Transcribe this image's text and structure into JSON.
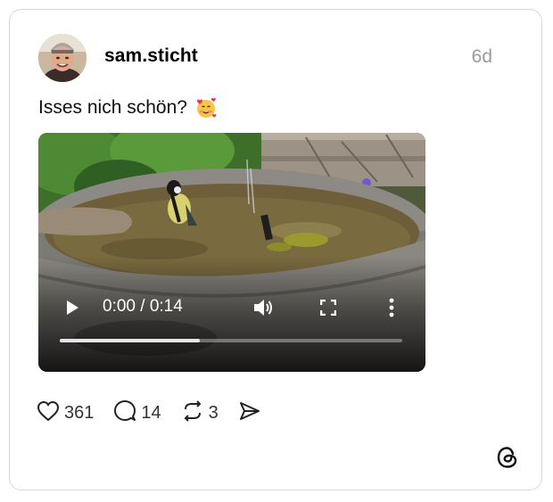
{
  "post": {
    "username": "sam.sticht",
    "time": "6d",
    "caption": "Isses nich schön?",
    "caption_emoji": "smiling-face-with-hearts-icon"
  },
  "video": {
    "timecode": "0:00 / 0:14",
    "progress": 0.41
  },
  "actions": {
    "likes": "361",
    "replies": "14",
    "reposts": "3"
  },
  "colors": {
    "muted": "#9a9a9a",
    "border": "#d8d8d8"
  }
}
